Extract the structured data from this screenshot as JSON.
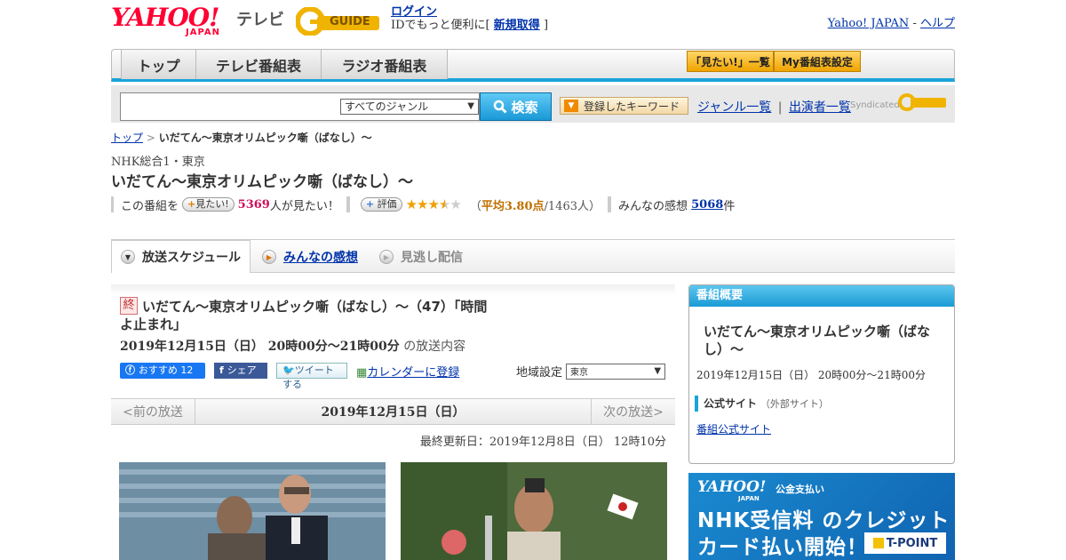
{
  "header": {
    "yahoo_word": "YAHOO!",
    "yahoo_japan": "JAPAN",
    "tv_label": "テレビ",
    "gguide_label": "GUIDE",
    "login_link": "ログイン",
    "login_text": "IDでもっと便利に[",
    "signup_link": "新規取得",
    "login_close": "]",
    "yj_link": "Yahoo! JAPAN",
    "sep": " - ",
    "help_link": "ヘルプ"
  },
  "nav": {
    "tabs": [
      "トップ",
      "テレビ番組表",
      "ラジオ番組表"
    ],
    "want_list": "「見たい!」一覧",
    "my_schedule": "My番組表設定"
  },
  "search": {
    "genre": "すべてのジャンル",
    "button": "検索",
    "keyword_button": "登録したキーワード",
    "genre_list": "ジャンル一覧",
    "divider": "|",
    "performer_list": "出演者一覧",
    "syndicated": "Syndicated"
  },
  "breadcrumb": {
    "top": "トップ",
    "arrow": " > ",
    "current": "いだてん～東京オリムピック噺（ばなし）～"
  },
  "program": {
    "channel": "NHK総合1・東京",
    "title": "いだてん～東京オリムピック噺（ばなし）～",
    "want_prefix": "この番組を",
    "want_button": "見たい!",
    "want_count": "5369",
    "want_suffix": "人が見たい！",
    "rate_button": "評価",
    "avg_open": "（",
    "avg_label": "平均3.80点",
    "avg_count": "/1463人）",
    "rating": 3.8,
    "impressions_label": "みんなの感想",
    "impressions_count": "5068",
    "impressions_unit": "件"
  },
  "tabs": {
    "schedule": "放送スケジュール",
    "impressions": "みんなの感想",
    "vod": "見逃し配信"
  },
  "episode": {
    "end_badge": "終",
    "title_line1": "いだてん～東京オリムピック噺（ばなし）～（47）「時間",
    "title_line2": "よ止まれ」",
    "date": "2019年12月15日（日） 20時00分～21時00分",
    "date_suffix": "の放送内容",
    "fb_recommend": "おすすめ 12",
    "fb_share": "シェア",
    "tweet": "ツイートする",
    "calendar": "カレンダーに登録",
    "region_label": "地域設定",
    "region_value": "東京"
  },
  "pager": {
    "prev": "<前の放送",
    "current": "2019年12月15日（日）",
    "next": "次の放送>"
  },
  "updated": "最終更新日：2019年12月8日（日） 12時10分",
  "sidebar": {
    "heading": "番組概要",
    "title": "いだてん～東京オリムピック噺（ばなし）～",
    "date": "2019年12月15日（日） 20時00分～21時00分",
    "official_label": "公式サイト",
    "official_note": "（外部サイト）",
    "official_link": "番組公式サイト"
  },
  "ad": {
    "yahoo": "YAHOO!",
    "japan": "JAPAN",
    "pub": "公金支払い",
    "line1": "NHK受信料 のクレジット",
    "line2": "カード払い開始！",
    "tpoint": "T-POINT"
  },
  "colors": {
    "accent_blue": "#1aa3d9",
    "yahoo_red": "#ff0033",
    "star": "#f0a000"
  }
}
